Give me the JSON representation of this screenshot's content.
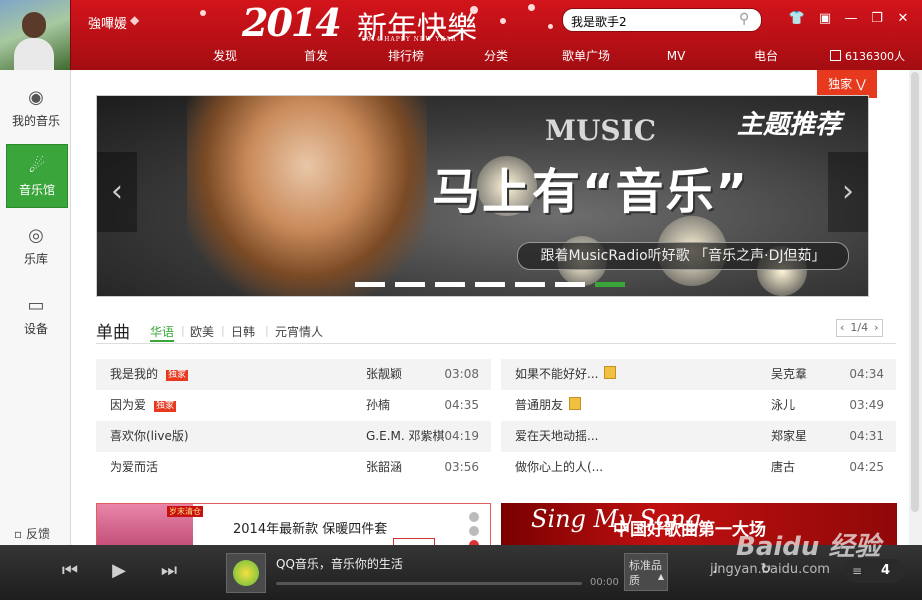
{
  "header": {
    "username": "強嗶媛",
    "banner_year": "2014",
    "banner_title": "新年快樂",
    "banner_subtitle": "2014 HAPPY NEW YEAR",
    "search_value": "我是歌手2",
    "nav": [
      "发现",
      "首发",
      "排行榜",
      "分类",
      "歌单广场",
      "MV",
      "电台"
    ],
    "listeners": "6136300人"
  },
  "sidebar": {
    "items": [
      {
        "label": "我的音乐",
        "icon": "headphones-icon"
      },
      {
        "label": "音乐馆",
        "icon": "music-hall-icon"
      },
      {
        "label": "乐库",
        "icon": "library-icon"
      },
      {
        "label": "设备",
        "icon": "device-icon"
      }
    ],
    "feedback": "反馈"
  },
  "main": {
    "exclusive_label": "独家",
    "carousel": {
      "music_word": "MUSIC",
      "theme": "主题推荐",
      "title": "马上有“音乐”",
      "caption": "跟着MusicRadio听好歌 「音乐之声·DJ但茹」",
      "slide_count": 7,
      "active_slide": 6
    },
    "singles": {
      "title": "单曲",
      "tabs": [
        "华语",
        "欧美",
        "日韩",
        "元宵情人"
      ],
      "active_tab": 0,
      "page": "1/4",
      "left": [
        {
          "name": "我是我的",
          "tag": "独家",
          "artist": "张靓颖",
          "time": "03:08"
        },
        {
          "name": "因为爱",
          "tag": "独家",
          "artist": "孙楠",
          "time": "04:35"
        },
        {
          "name": "喜欢你(live版)",
          "tag": "",
          "artist": "G.E.M. 邓紫棋",
          "time": "04:19"
        },
        {
          "name": "为爱而活",
          "tag": "",
          "artist": "张韶涵",
          "time": "03:56"
        }
      ],
      "right": [
        {
          "name": "如果不能好好...",
          "mv": true,
          "artist": "吴克羣",
          "time": "04:34"
        },
        {
          "name": "普通朋友",
          "mv": true,
          "artist": "泳儿",
          "time": "03:49"
        },
        {
          "name": "爱在天地动摇...",
          "mv": false,
          "artist": "郑家星",
          "time": "04:31"
        },
        {
          "name": "做你心上的人(...",
          "mv": false,
          "artist": "唐古",
          "time": "04:25"
        }
      ]
    },
    "ads": {
      "left_tag": "岁末清仓",
      "left_text": "2014年最新款 保暖四件套",
      "right_logo": "Sing My Song",
      "right_text": "中国好歌曲第一大场"
    }
  },
  "player": {
    "now_playing": "QQ音乐，音乐你的生活",
    "time": "00:00",
    "quality": "标准品质",
    "playlist_count": "4"
  },
  "watermark": {
    "brand": "Baidu 经验",
    "url": "jingyan.baidu.com"
  }
}
